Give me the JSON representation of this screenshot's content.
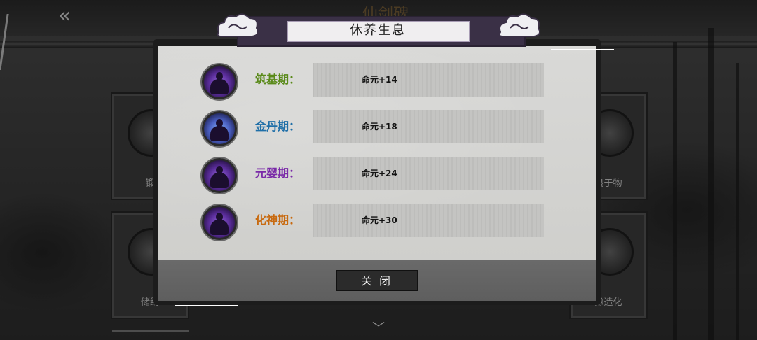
{
  "background": {
    "title": "仙剑碑",
    "back_icon": "double-arrow-left-icon",
    "cards": [
      {
        "label": "锻"
      },
      {
        "label": "良于物"
      },
      {
        "label": "储纳"
      },
      {
        "label": "豫造化"
      }
    ]
  },
  "dialog": {
    "title": "休养生息",
    "rows": [
      {
        "stage": "筑基期：",
        "value": "命元+14",
        "color": "#5a8a1a"
      },
      {
        "stage": "金丹期：",
        "value": "命元+18",
        "color": "#1f6fa8"
      },
      {
        "stage": "元婴期：",
        "value": "命元+24",
        "color": "#7a2aa8"
      },
      {
        "stage": "化神期：",
        "value": "命元+30",
        "color": "#c86a10"
      }
    ],
    "close_label": "关闭"
  }
}
